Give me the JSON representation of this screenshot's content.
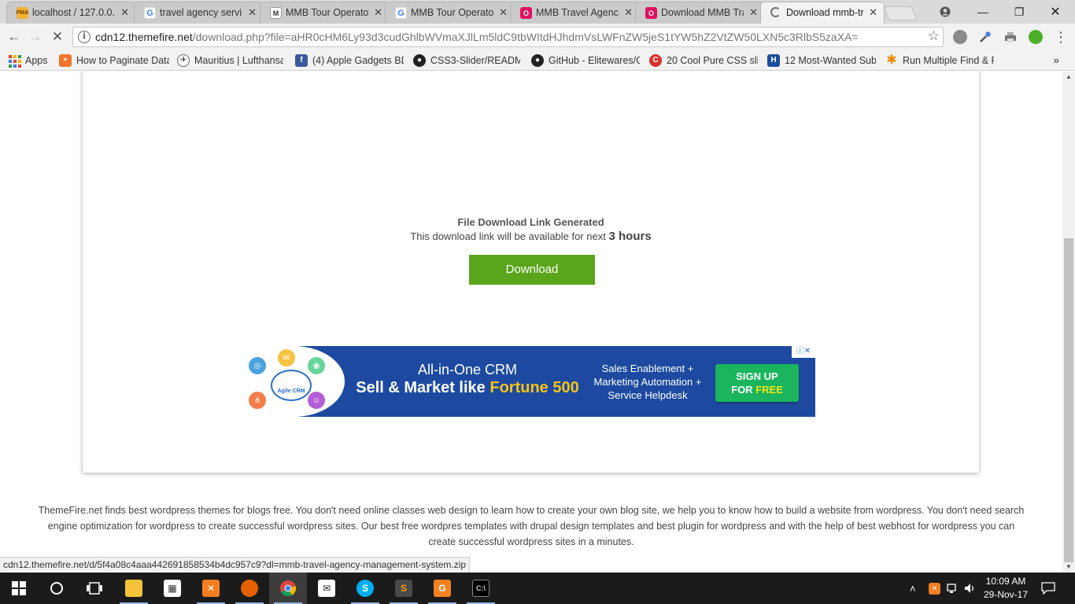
{
  "tabs": [
    {
      "title": "localhost / 127.0.0.",
      "icon": "phpmyadmin-icon",
      "fav": "PMA"
    },
    {
      "title": "travel agency servi",
      "icon": "google-icon",
      "fav": "G"
    },
    {
      "title": "MMB Tour Operato",
      "icon": "mmb-site-icon",
      "fav": "M"
    },
    {
      "title": "MMB Tour Operato",
      "icon": "google-icon",
      "fav": "G"
    },
    {
      "title": "MMB Travel Agenc",
      "icon": "opera-icon",
      "fav": "O"
    },
    {
      "title": "Download MMB Tra",
      "icon": "opera-icon",
      "fav": "O"
    },
    {
      "title": "Download mmb-tr",
      "icon": "loading-spinner-icon",
      "fav": ""
    }
  ],
  "toolbar": {
    "url_host": "cdn12.themefire.net",
    "url_path": "/download.php?file=aHR0cHM6Ly93d3cudGhlbWVmaXJlLm5ldC9tbWItdHJhdmVsLWFnZW5jeS1tYW5hZ2VtZW50LXN5c3RlbS5zaXA="
  },
  "bookmarks": [
    {
      "label": "Apps",
      "icon": "apps-grid-icon"
    },
    {
      "label": "How to Paginate Data",
      "icon": "bookmark-orange-icon",
      "fav": "+"
    },
    {
      "label": "Mauritius | Lufthansa",
      "icon": "lufthansa-icon",
      "fav": "✈"
    },
    {
      "label": "(4) Apple Gadgets BD",
      "icon": "facebook-icon",
      "fav": "f"
    },
    {
      "label": "CSS3-Slider/README",
      "icon": "github-icon",
      "fav": "●"
    },
    {
      "label": "GitHub - Elitewares/C",
      "icon": "github-icon",
      "fav": "●"
    },
    {
      "label": "20 Cool Pure CSS slid",
      "icon": "codrops-icon",
      "fav": "C"
    },
    {
      "label": "12 Most-Wanted Sub",
      "icon": "hongkiat-icon",
      "fav": "H"
    },
    {
      "label": "Run Multiple Find & R",
      "icon": "asterisk-icon",
      "fav": "✱"
    }
  ],
  "page": {
    "title": "File Download Link Generated",
    "subtitle_prefix": "This download link will be available for next",
    "hours": "3 hours",
    "download_label": "Download",
    "footer": "ThemeFire.net finds best wordpress themes for blogs free. You don't need online classes web design to learn how to create your own blog site, we help you to know how to build a website from wordpress. You don't need search engine optimization for wordpress to create successful wordpress sites. Our best free wordpres templates with drupal design templates and best plugin for wordpress and with the help of best webhost for wordpress you can create successful wordpress sites in a minutes."
  },
  "ad": {
    "brand": "Agile CRM",
    "headline1": "All-in-One CRM",
    "headline2_prefix": "Sell & Market like",
    "headline2_highlight": "Fortune 500",
    "features": "Sales Enablement + Marketing Automation + Service Helpdesk",
    "cta_line1": "SIGN UP",
    "cta_line2_prefix": "FOR",
    "cta_line2_highlight": "FREE",
    "choice": "ⓘ✕"
  },
  "status_bar": "cdn12.themefire.net/d/5f4a08c4aaa442691858534b4dc957c9?dl=mmb-travel-agency-management-system.zip",
  "taskbar": {
    "time": "10:09 AM",
    "date": "29-Nov-17",
    "apps": [
      "start-icon",
      "cortana-icon",
      "task-view-icon",
      "file-explorer-icon",
      "store-icon",
      "xampp-icon",
      "firefox-icon",
      "chrome-icon",
      "mail-icon",
      "skype-icon",
      "sublime-icon",
      "reader-icon",
      "cmd-icon"
    ]
  },
  "colors": {
    "download_button": "#5aa51c",
    "ad_background": "#1d4aa0",
    "ad_cta": "#1ab55d",
    "ad_highlight": "#f7c318"
  }
}
